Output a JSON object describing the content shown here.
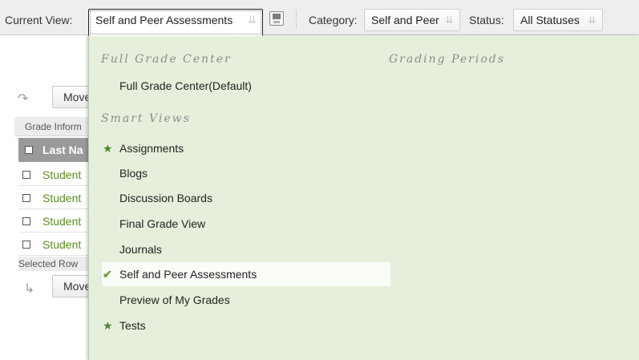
{
  "toolbar": {
    "current_view_label": "Current View:",
    "current_view_value": "Self and Peer Assessments",
    "category_label": "Category:",
    "category_value": "Self and Peer",
    "status_label": "Status:",
    "status_value": "All Statuses",
    "chevron_icon": "double-chevron-down-icon",
    "save_icon": "save-disk-icon"
  },
  "background": {
    "move_button_top": "Move",
    "grade_info_bar": "Grade Inform",
    "column_header": "Last Na",
    "rows": [
      "Student",
      "Student",
      "Student",
      "Student"
    ],
    "selected_rows_bar": "Selected Row",
    "move_button_bottom": "Move"
  },
  "menu": {
    "full_grade_center_heading": "Full Grade Center",
    "grading_periods_heading": "Grading Periods",
    "smart_views_heading": "Smart Views",
    "full_grade_center_default": "Full Grade Center(Default)",
    "items": [
      {
        "label": "Assignments",
        "icon": "star-icon",
        "selected": false
      },
      {
        "label": "Blogs",
        "icon": "",
        "selected": false
      },
      {
        "label": "Discussion Boards",
        "icon": "",
        "selected": false
      },
      {
        "label": "Final Grade View",
        "icon": "",
        "selected": false
      },
      {
        "label": "Journals",
        "icon": "",
        "selected": false
      },
      {
        "label": "Self and Peer Assessments",
        "icon": "checkmark-icon",
        "selected": true
      },
      {
        "label": "Preview of My Grades",
        "icon": "",
        "selected": false
      },
      {
        "label": "Tests",
        "icon": "star-icon",
        "selected": false
      }
    ]
  },
  "colors": {
    "menu_background": "#e6efdb",
    "menu_highlight": "#fafcf7",
    "link_green": "#5a8f1e",
    "star_green": "#4c8a2c",
    "check_green": "#6aa03c"
  }
}
